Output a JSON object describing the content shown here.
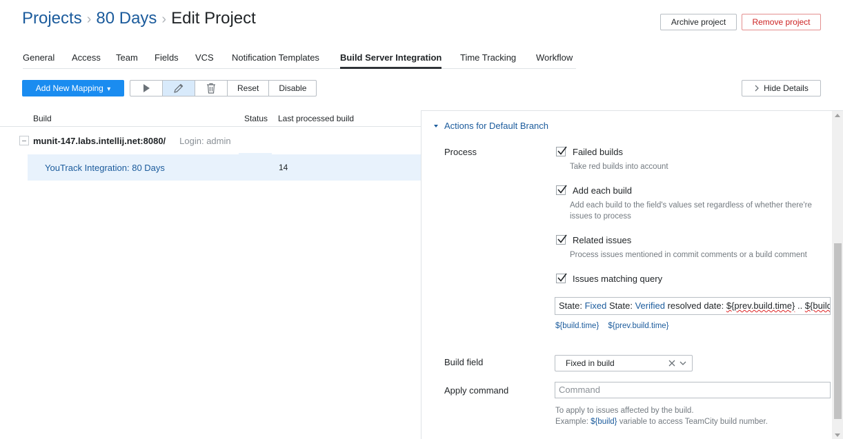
{
  "breadcrumb": {
    "projects": "Projects",
    "project": "80 Days",
    "separator": "›",
    "current": "Edit Project"
  },
  "header_buttons": {
    "archive": "Archive project",
    "remove": "Remove project"
  },
  "tabs": [
    {
      "label": "General"
    },
    {
      "label": "Access"
    },
    {
      "label": "Team"
    },
    {
      "label": "Fields"
    },
    {
      "label": "VCS"
    },
    {
      "label": "Notification Templates"
    },
    {
      "label": "Build Server Integration",
      "active": true
    },
    {
      "label": "Time Tracking"
    },
    {
      "label": "Workflow"
    }
  ],
  "toolbar": {
    "add_mapping": "Add New Mapping",
    "add_mapping_caret": "▾",
    "run_icon": "play-icon",
    "edit_icon": "pencil-icon",
    "delete_icon": "trash-icon",
    "reset": "Reset",
    "disable": "Disable",
    "hide_details": "Hide Details"
  },
  "table": {
    "columns": {
      "build": "Build",
      "status": "Status",
      "last_processed": "Last processed build"
    },
    "server": {
      "name": "munit-147.labs.intellij.net:8080/",
      "login": "Login: admin"
    },
    "mapping": {
      "name": "YouTrack Integration: 80 Days",
      "last_processed": "14"
    }
  },
  "details": {
    "section_title": "Actions for Default Branch",
    "process_label": "Process",
    "options": [
      {
        "label": "Failed builds",
        "description": "Take red builds into account",
        "checked": true
      },
      {
        "label": "Add each build",
        "description": "Add each build to the field's values set regardless of whether there're issues to process",
        "checked": true
      },
      {
        "label": "Related issues",
        "description": "Process issues mentioned in commit comments or a build comment",
        "checked": true
      },
      {
        "label": "Issues matching query",
        "description": "",
        "checked": true
      }
    ],
    "query": {
      "p1": "State: ",
      "p2": "Fixed",
      "p3": " State: ",
      "p4": "Verified",
      "p5": " resolved date: ",
      "p6": "${prev.build.time}",
      "p7": " .. ",
      "p8": "${build.time}"
    },
    "query_vars": [
      "${build.time}",
      "${prev.build.time}"
    ],
    "build_field_label": "Build field",
    "build_field_value": "Fixed in build",
    "apply_command_label": "Apply command",
    "apply_command_placeholder": "Command",
    "apply_help_line1": "To apply to issues affected by the build.",
    "apply_help_prefix": "Example: ",
    "apply_help_var": "${build}",
    "apply_help_suffix": " variable to access TeamCity build number."
  },
  "colors": {
    "link": "#1b5b9c",
    "primary": "#1a8cf0",
    "danger": "#cc2222",
    "selection": "#e8f2fc"
  }
}
